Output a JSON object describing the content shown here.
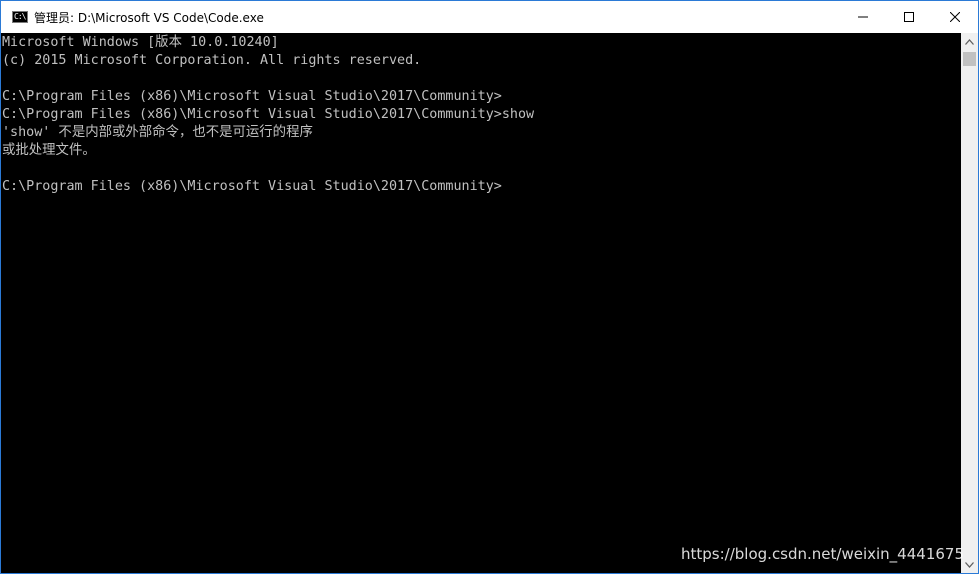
{
  "window": {
    "title": "管理员: D:\\Microsoft VS Code\\Code.exe",
    "icon": "console-app-icon",
    "icon_glyph": "C:\\"
  },
  "controls": {
    "minimize": "minimize-icon",
    "maximize": "maximize-icon",
    "close": "close-icon"
  },
  "console": {
    "lines": [
      "Microsoft Windows [版本 10.0.10240]",
      "(c) 2015 Microsoft Corporation. All rights reserved.",
      "",
      "C:\\Program Files (x86)\\Microsoft Visual Studio\\2017\\Community>",
      "C:\\Program Files (x86)\\Microsoft Visual Studio\\2017\\Community>show",
      "'show' 不是内部或外部命令，也不是可运行的程序",
      "或批处理文件。",
      "",
      "C:\\Program Files (x86)\\Microsoft Visual Studio\\2017\\Community>"
    ]
  },
  "watermark": "https://blog.csdn.net/weixin_4441675",
  "colors": {
    "console_bg": "#000000",
    "console_text": "#c0c0c0",
    "border": "#2b7ad6"
  }
}
